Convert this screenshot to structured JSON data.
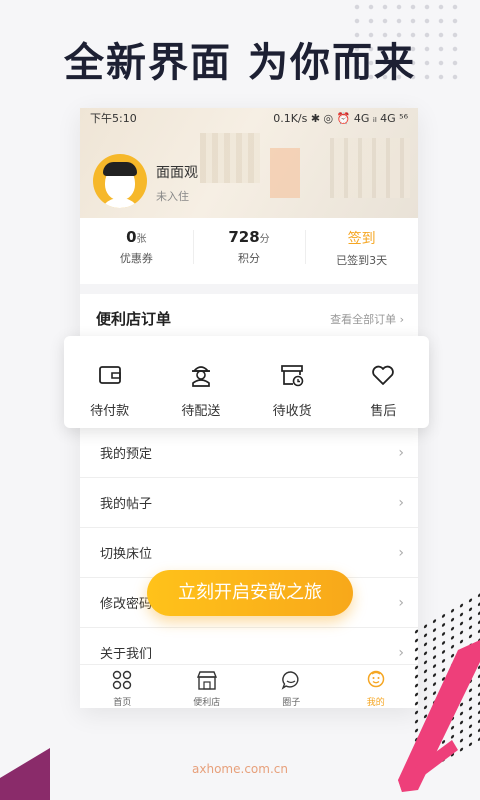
{
  "headline": "全新界面  为你而来",
  "status_bar": {
    "time": "下午5:10",
    "right": "0.1K/s ✱ ◎ ⏰ 4G ᵢₗ 4G ⁵⁶"
  },
  "profile": {
    "name": "面面观",
    "status": "未入住"
  },
  "stats": [
    {
      "value": "0",
      "unit": "张",
      "label": "优惠券"
    },
    {
      "value": "728",
      "unit": "分",
      "label": "积分"
    },
    {
      "value": "签到",
      "unit": "",
      "label": "已签到3天"
    }
  ],
  "orders": {
    "title": "便利店订单",
    "more": "查看全部订单 ›",
    "items": [
      {
        "label": "待付款",
        "icon": "wallet-icon"
      },
      {
        "label": "待配送",
        "icon": "courier-icon"
      },
      {
        "label": "待收货",
        "icon": "box-clock-icon"
      },
      {
        "label": "售后",
        "icon": "heart-icon"
      }
    ]
  },
  "menu": [
    {
      "label": "我的预定"
    },
    {
      "label": "我的帖子"
    },
    {
      "label": "切换床位"
    },
    {
      "label": "修改密码"
    },
    {
      "label": "关于我们"
    }
  ],
  "tabs": [
    {
      "label": "首页",
      "icon": "home-grid-icon"
    },
    {
      "label": "便利店",
      "icon": "shop-icon"
    },
    {
      "label": "圈子",
      "icon": "chat-icon"
    },
    {
      "label": "我的",
      "icon": "profile-icon",
      "active": true
    }
  ],
  "cta": "立刻开启安歆之旅",
  "footer_url": "axhome.com.cn",
  "colors": {
    "accent": "#f5a623",
    "headline": "#1d2033",
    "pink": "#ee3f7a",
    "purple": "#8a2b6a"
  }
}
